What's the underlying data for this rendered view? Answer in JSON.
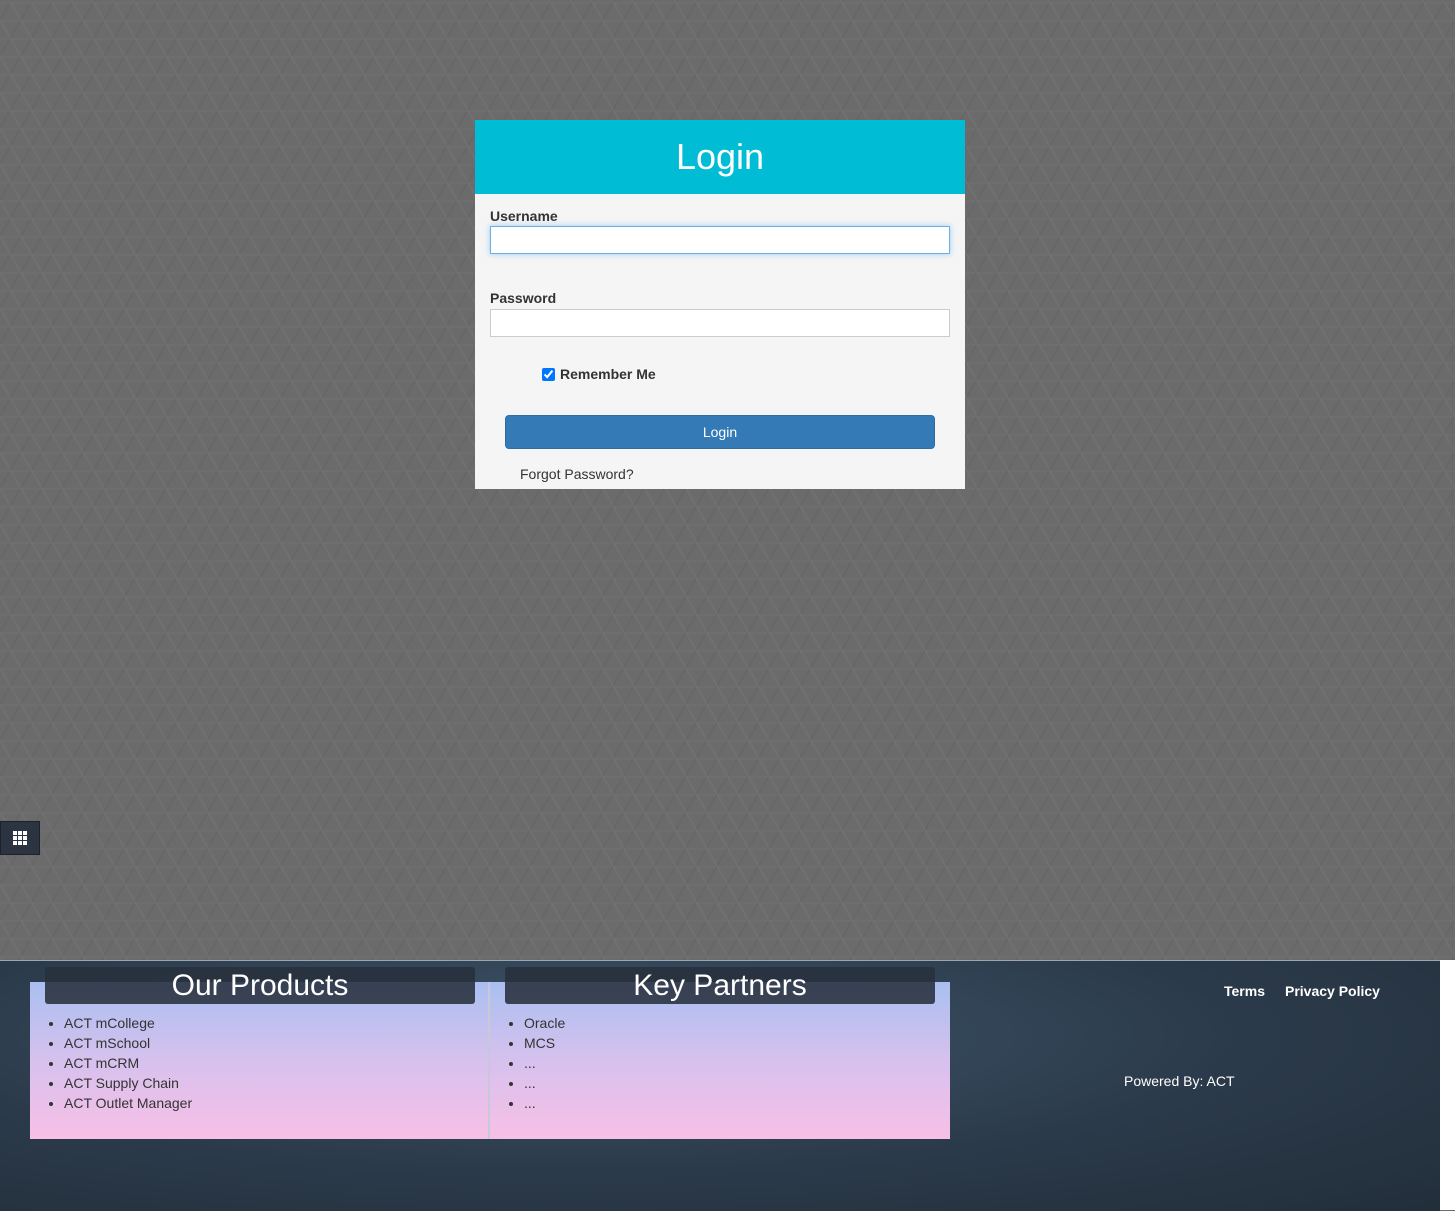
{
  "login": {
    "title": "Login",
    "username_label": "Username",
    "username_value": "",
    "password_label": "Password",
    "password_value": "",
    "remember_label": "Remember Me",
    "remember_checked": true,
    "submit_label": "Login",
    "forgot_label": "Forgot Password?"
  },
  "side_toggle": {
    "icon": "grid-icon"
  },
  "footer": {
    "products": {
      "title": "Our Products",
      "items": [
        "ACT mCollege",
        "ACT mSchool",
        "ACT mCRM",
        "ACT Supply Chain",
        "ACT Outlet Manager"
      ]
    },
    "partners": {
      "title": "Key Partners",
      "items": [
        "Oracle",
        "MCS",
        "...",
        "...",
        "..."
      ]
    },
    "links": {
      "terms": "Terms",
      "privacy": "Privacy Policy"
    },
    "powered_by": "Powered By: ACT"
  },
  "colors": {
    "header": "#00bcd4",
    "button": "#337ab7"
  }
}
